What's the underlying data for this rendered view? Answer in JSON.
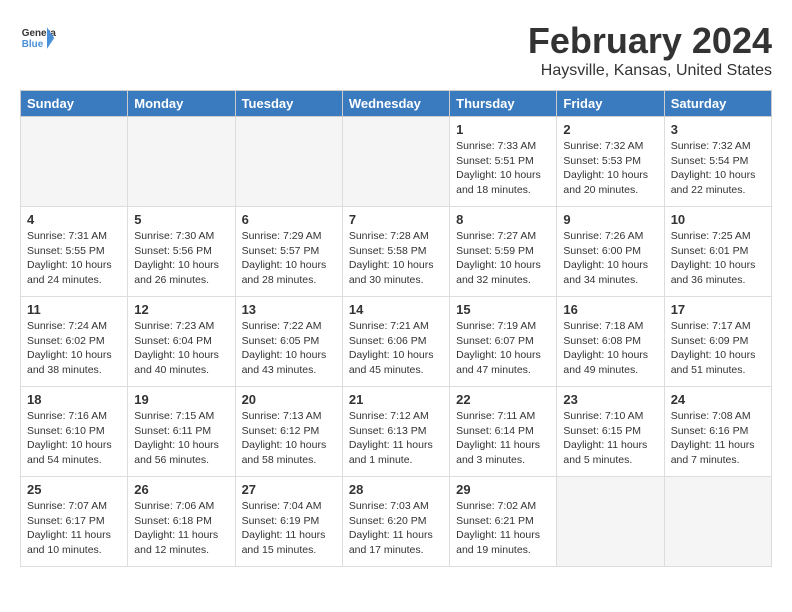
{
  "header": {
    "logo_line1": "General",
    "logo_line2": "Blue",
    "month": "February 2024",
    "location": "Haysville, Kansas, United States"
  },
  "days_of_week": [
    "Sunday",
    "Monday",
    "Tuesday",
    "Wednesday",
    "Thursday",
    "Friday",
    "Saturday"
  ],
  "weeks": [
    [
      {
        "day": "",
        "empty": true
      },
      {
        "day": "",
        "empty": true
      },
      {
        "day": "",
        "empty": true
      },
      {
        "day": "",
        "empty": true
      },
      {
        "day": "1",
        "sunrise": "7:33 AM",
        "sunset": "5:51 PM",
        "daylight": "10 hours and 18 minutes."
      },
      {
        "day": "2",
        "sunrise": "7:32 AM",
        "sunset": "5:53 PM",
        "daylight": "10 hours and 20 minutes."
      },
      {
        "day": "3",
        "sunrise": "7:32 AM",
        "sunset": "5:54 PM",
        "daylight": "10 hours and 22 minutes."
      }
    ],
    [
      {
        "day": "4",
        "sunrise": "7:31 AM",
        "sunset": "5:55 PM",
        "daylight": "10 hours and 24 minutes."
      },
      {
        "day": "5",
        "sunrise": "7:30 AM",
        "sunset": "5:56 PM",
        "daylight": "10 hours and 26 minutes."
      },
      {
        "day": "6",
        "sunrise": "7:29 AM",
        "sunset": "5:57 PM",
        "daylight": "10 hours and 28 minutes."
      },
      {
        "day": "7",
        "sunrise": "7:28 AM",
        "sunset": "5:58 PM",
        "daylight": "10 hours and 30 minutes."
      },
      {
        "day": "8",
        "sunrise": "7:27 AM",
        "sunset": "5:59 PM",
        "daylight": "10 hours and 32 minutes."
      },
      {
        "day": "9",
        "sunrise": "7:26 AM",
        "sunset": "6:00 PM",
        "daylight": "10 hours and 34 minutes."
      },
      {
        "day": "10",
        "sunrise": "7:25 AM",
        "sunset": "6:01 PM",
        "daylight": "10 hours and 36 minutes."
      }
    ],
    [
      {
        "day": "11",
        "sunrise": "7:24 AM",
        "sunset": "6:02 PM",
        "daylight": "10 hours and 38 minutes."
      },
      {
        "day": "12",
        "sunrise": "7:23 AM",
        "sunset": "6:04 PM",
        "daylight": "10 hours and 40 minutes."
      },
      {
        "day": "13",
        "sunrise": "7:22 AM",
        "sunset": "6:05 PM",
        "daylight": "10 hours and 43 minutes."
      },
      {
        "day": "14",
        "sunrise": "7:21 AM",
        "sunset": "6:06 PM",
        "daylight": "10 hours and 45 minutes."
      },
      {
        "day": "15",
        "sunrise": "7:19 AM",
        "sunset": "6:07 PM",
        "daylight": "10 hours and 47 minutes."
      },
      {
        "day": "16",
        "sunrise": "7:18 AM",
        "sunset": "6:08 PM",
        "daylight": "10 hours and 49 minutes."
      },
      {
        "day": "17",
        "sunrise": "7:17 AM",
        "sunset": "6:09 PM",
        "daylight": "10 hours and 51 minutes."
      }
    ],
    [
      {
        "day": "18",
        "sunrise": "7:16 AM",
        "sunset": "6:10 PM",
        "daylight": "10 hours and 54 minutes."
      },
      {
        "day": "19",
        "sunrise": "7:15 AM",
        "sunset": "6:11 PM",
        "daylight": "10 hours and 56 minutes."
      },
      {
        "day": "20",
        "sunrise": "7:13 AM",
        "sunset": "6:12 PM",
        "daylight": "10 hours and 58 minutes."
      },
      {
        "day": "21",
        "sunrise": "7:12 AM",
        "sunset": "6:13 PM",
        "daylight": "11 hours and 1 minute."
      },
      {
        "day": "22",
        "sunrise": "7:11 AM",
        "sunset": "6:14 PM",
        "daylight": "11 hours and 3 minutes."
      },
      {
        "day": "23",
        "sunrise": "7:10 AM",
        "sunset": "6:15 PM",
        "daylight": "11 hours and 5 minutes."
      },
      {
        "day": "24",
        "sunrise": "7:08 AM",
        "sunset": "6:16 PM",
        "daylight": "11 hours and 7 minutes."
      }
    ],
    [
      {
        "day": "25",
        "sunrise": "7:07 AM",
        "sunset": "6:17 PM",
        "daylight": "11 hours and 10 minutes."
      },
      {
        "day": "26",
        "sunrise": "7:06 AM",
        "sunset": "6:18 PM",
        "daylight": "11 hours and 12 minutes."
      },
      {
        "day": "27",
        "sunrise": "7:04 AM",
        "sunset": "6:19 PM",
        "daylight": "11 hours and 15 minutes."
      },
      {
        "day": "28",
        "sunrise": "7:03 AM",
        "sunset": "6:20 PM",
        "daylight": "11 hours and 17 minutes."
      },
      {
        "day": "29",
        "sunrise": "7:02 AM",
        "sunset": "6:21 PM",
        "daylight": "11 hours and 19 minutes."
      },
      {
        "day": "",
        "empty": true
      },
      {
        "day": "",
        "empty": true
      }
    ]
  ]
}
